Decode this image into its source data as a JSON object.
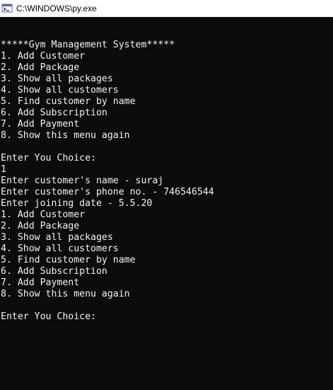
{
  "window": {
    "title": "C:\\WINDOWS\\py.exe",
    "icon": "python-launcher-icon"
  },
  "console": {
    "lines": [
      "*****Gym Management System*****",
      "1. Add Customer",
      "2. Add Package",
      "3. Show all packages",
      "4. Show all customers",
      "5. Find customer by name",
      "6. Add Subscription",
      "7. Add Payment",
      "8. Show this menu again",
      "",
      "Enter You Choice:",
      "1",
      "Enter customer's name - suraj",
      "Enter customer's phone no. - 746546544",
      "Enter joining date - 5.5.20",
      "1. Add Customer",
      "2. Add Package",
      "3. Show all packages",
      "4. Show all customers",
      "5. Find customer by name",
      "6. Add Subscription",
      "7. Add Payment",
      "8. Show this menu again",
      "",
      "Enter You Choice:"
    ]
  },
  "colors": {
    "background": "#0c0c0c",
    "text": "#f2f2f2",
    "titlebar": "#ffffff"
  }
}
